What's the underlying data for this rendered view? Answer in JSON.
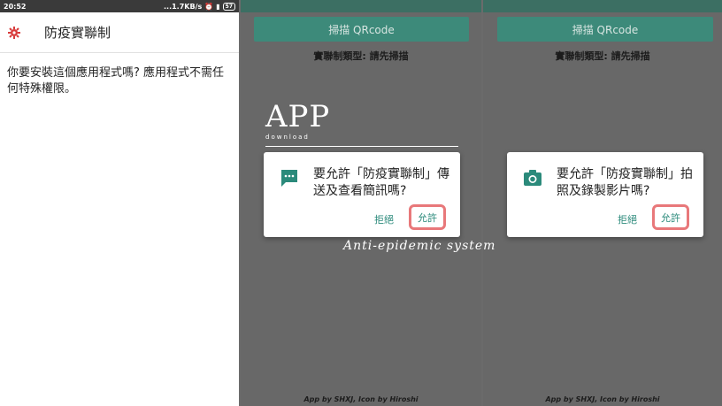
{
  "status_bar": {
    "time": "20:52",
    "network": "...1.7KB/s",
    "battery": "57"
  },
  "installer": {
    "app_title": "防疫實聯制",
    "message": "你要安裝這個應用程式嗎? 應用程式不需任何特殊權限。"
  },
  "app_screen": {
    "scan_button": "掃描 QRcode",
    "type_label": "實聯制類型: 請先掃描",
    "footer": "App by SHXJ, Icon by Hiroshi"
  },
  "sms_dialog": {
    "icon": "message-icon",
    "text": "要允許「防疫實聯制」傳送及查看簡訊嗎?",
    "deny": "拒絕",
    "allow": "允許"
  },
  "camera_dialog": {
    "icon": "camera-icon",
    "text": "要允許「防疫實聯制」拍照及錄製影片嗎?",
    "deny": "拒絕",
    "allow": "允許"
  },
  "overlay": {
    "title": "APP",
    "subtitle": "download",
    "script": "Anti-epidemic system"
  },
  "colors": {
    "accent": "#2b8a7b",
    "highlight": "#e8787a",
    "button": "#3d8a7a"
  }
}
